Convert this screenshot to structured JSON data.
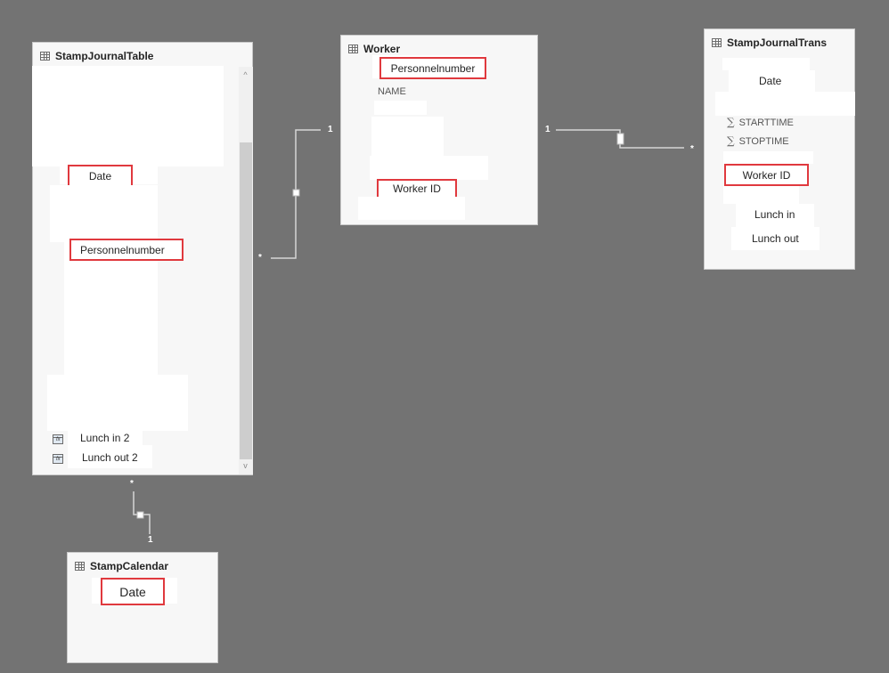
{
  "tables": {
    "stamp_journal_table": {
      "title": "StampJournalTable",
      "fields": {
        "date": "Date",
        "personnelnumber": "Personnelnumber",
        "lunch_in_2": "Lunch in 2",
        "lunch_out_2": "Lunch out 2"
      },
      "scroll_up": "^",
      "scroll_down": "v"
    },
    "worker": {
      "title": "Worker",
      "fields": {
        "personnelnumber": "Personnelnumber",
        "name": "NAME",
        "worker_id": "Worker ID"
      }
    },
    "stamp_journal_trans": {
      "title": "StampJournalTrans",
      "fields": {
        "date": "Date",
        "starttime": "STARTTIME",
        "stoptime": "STOPTIME",
        "worker_id": "Worker ID",
        "lunch_in": "Lunch in",
        "lunch_out": "Lunch out"
      },
      "sigma": "∑"
    },
    "stamp_calendar": {
      "title": "StampCalendar",
      "fields": {
        "date": "Date"
      }
    }
  },
  "relationships": [
    {
      "from": "StampJournalTable",
      "to": "Worker",
      "from_card": "*",
      "to_card": "1"
    },
    {
      "from": "Worker",
      "to": "StampJournalTrans",
      "from_card": "1",
      "to_card": "*"
    },
    {
      "from": "StampJournalTable",
      "to": "StampCalendar",
      "from_card": "*",
      "to_card": "1"
    }
  ],
  "colors": {
    "canvas": "#737373",
    "highlight": "#e0393e"
  }
}
